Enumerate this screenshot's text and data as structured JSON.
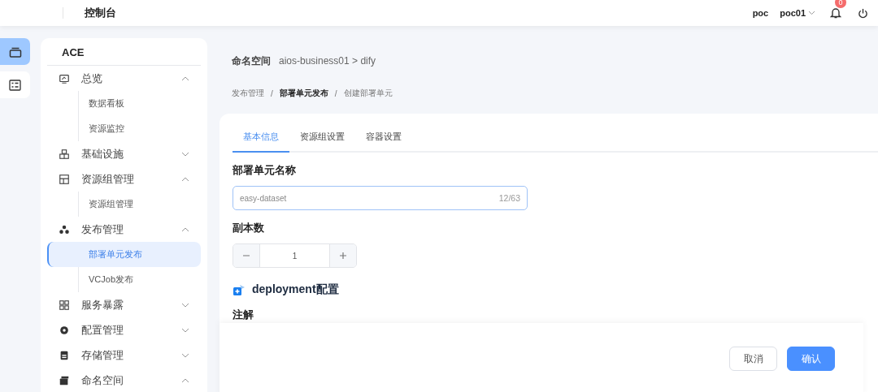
{
  "topbar": {
    "title": "控制台",
    "tenant": "poc",
    "user": "poc01",
    "notification_count": "0"
  },
  "rail": [
    {
      "selected": true
    },
    {
      "selected": false
    }
  ],
  "sidebar": {
    "title": "ACE",
    "groups": [
      {
        "label": "总览",
        "expanded": true,
        "children": [
          {
            "label": "数据看板",
            "selected": false
          },
          {
            "label": "资源监控",
            "selected": false
          }
        ]
      },
      {
        "label": "基础设施",
        "expanded": false
      },
      {
        "label": "资源组管理",
        "expanded": true,
        "children": [
          {
            "label": "资源组管理",
            "selected": false
          }
        ]
      },
      {
        "label": "发布管理",
        "expanded": true,
        "children": [
          {
            "label": "部署单元发布",
            "selected": true
          },
          {
            "label": "VCJob发布",
            "selected": false
          }
        ]
      },
      {
        "label": "服务暴露",
        "expanded": false
      },
      {
        "label": "配置管理",
        "expanded": false
      },
      {
        "label": "存储管理",
        "expanded": false
      },
      {
        "label": "命名空间",
        "expanded": true
      }
    ]
  },
  "namespace": {
    "label": "命名空间",
    "path": "aios-business01 > dify"
  },
  "breadcrumb": [
    {
      "label": "发布管理",
      "emphasized": false
    },
    {
      "separator": "/"
    },
    {
      "label": "部署单元发布",
      "emphasized": true
    },
    {
      "separator": "/"
    },
    {
      "label": "创建部署单元",
      "emphasized": false
    }
  ],
  "tabs": [
    {
      "label": "基本信息",
      "selected": true
    },
    {
      "label": "资源组设置",
      "selected": false
    },
    {
      "label": "容器设置",
      "selected": false
    }
  ],
  "form": {
    "name_label": "部署单元名称",
    "name_value": "easy-dataset",
    "name_count": "12/63",
    "replicas_label": "副本数",
    "replicas_value": "1",
    "section_title": "deployment配置",
    "annotations_label": "注解"
  },
  "footer": {
    "buttons": [
      {
        "label": "取消",
        "kind": "secondary"
      },
      {
        "label": "确认",
        "kind": "primary"
      }
    ]
  }
}
